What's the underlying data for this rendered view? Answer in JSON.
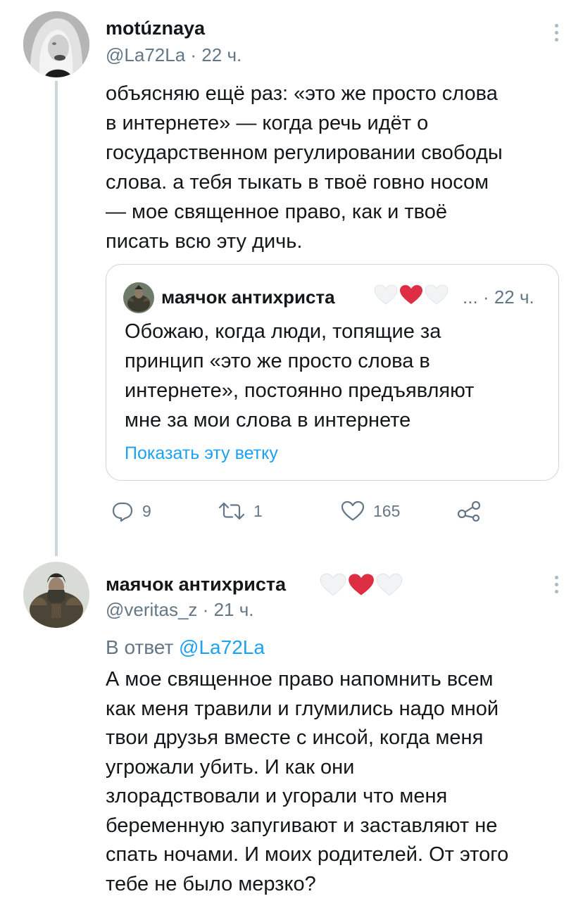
{
  "tweet1": {
    "author_name": "motúznaya",
    "handle": "@La72La",
    "separator": "·",
    "time": "22 ч.",
    "text": "объясняю ещё раз: «это же просто слова\nв интернете» — когда речь идёт о\nгосударственном регулировании свободы\nслова. а тебя тыкать в твоё говно носом\n— мое священное право, как и твоё\nписать всю эту дичь.",
    "quoted": {
      "author_name": "маячок антихриста",
      "ellipsis": "...",
      "separator": "·",
      "time": "22 ч.",
      "text": "Обожаю, когда люди, топящие за\nпринцип «это же просто слова в\nинтернете», постоянно предъявляют\nмне за мои слова в интернете",
      "show_thread": "Показать эту ветку",
      "heart_icons": [
        "white-heart-icon",
        "red-heart-icon",
        "white-heart-icon"
      ]
    },
    "actions": {
      "replies": "9",
      "retweets": "1",
      "likes": "165"
    }
  },
  "tweet2": {
    "author_name": "маячок антихриста",
    "handle": "@veritas_z",
    "separator": "·",
    "time": "21 ч.",
    "reply_prefix": "В ответ",
    "reply_handle": "@La72La",
    "text": "А мое священное право напомнить всем\nкак меня травили и глумились надо мной\nтвои друзья вместе с инсой, когда меня\nугрожали убить. И как они\nзлорадствовали и угорали что меня\nбеременную запугивают и заставляют не\nспать ночами. И моих родителей. От этого\nтебе не было мерзко?",
    "heart_icons": [
      "white-heart-icon",
      "red-heart-icon",
      "white-heart-icon"
    ]
  },
  "colors": {
    "text": "#14171a",
    "secondary": "#657786",
    "link": "#1da1f2",
    "border": "#ccd6dd",
    "heart_red": "#e0245e"
  }
}
